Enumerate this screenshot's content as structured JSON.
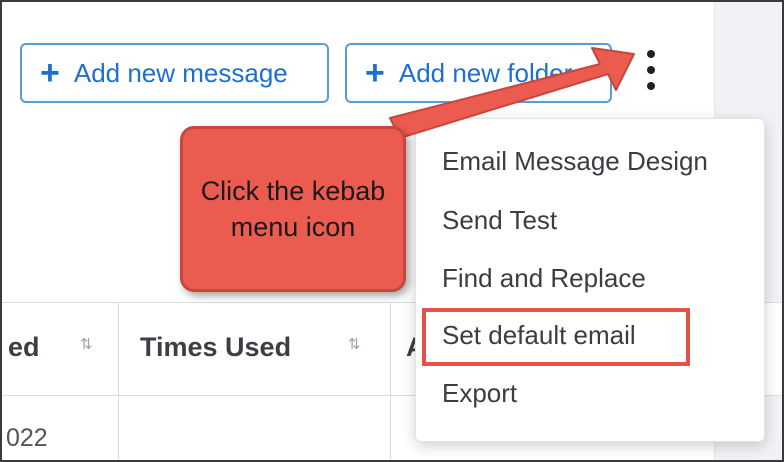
{
  "toolbar": {
    "add_message_label": "Add new message",
    "add_folder_label": "Add new folder",
    "plus_icon": "plus-icon",
    "kebab_icon": "kebab-menu-icon"
  },
  "menu": {
    "items": [
      {
        "label": "Email Message Design"
      },
      {
        "label": "Send Test"
      },
      {
        "label": "Find and Replace"
      },
      {
        "label": "Set default email"
      },
      {
        "label": "Export"
      }
    ]
  },
  "table": {
    "headers": [
      {
        "label": "ed"
      },
      {
        "label": "Times Used"
      },
      {
        "label": "A"
      }
    ],
    "rows": [
      {
        "cells": [
          "022"
        ]
      }
    ]
  },
  "callout": {
    "text": "Click the kebab menu icon"
  },
  "colors": {
    "accent": "#1f6fd1",
    "callout": "#ec5b4f",
    "highlight": "#e4534a"
  }
}
